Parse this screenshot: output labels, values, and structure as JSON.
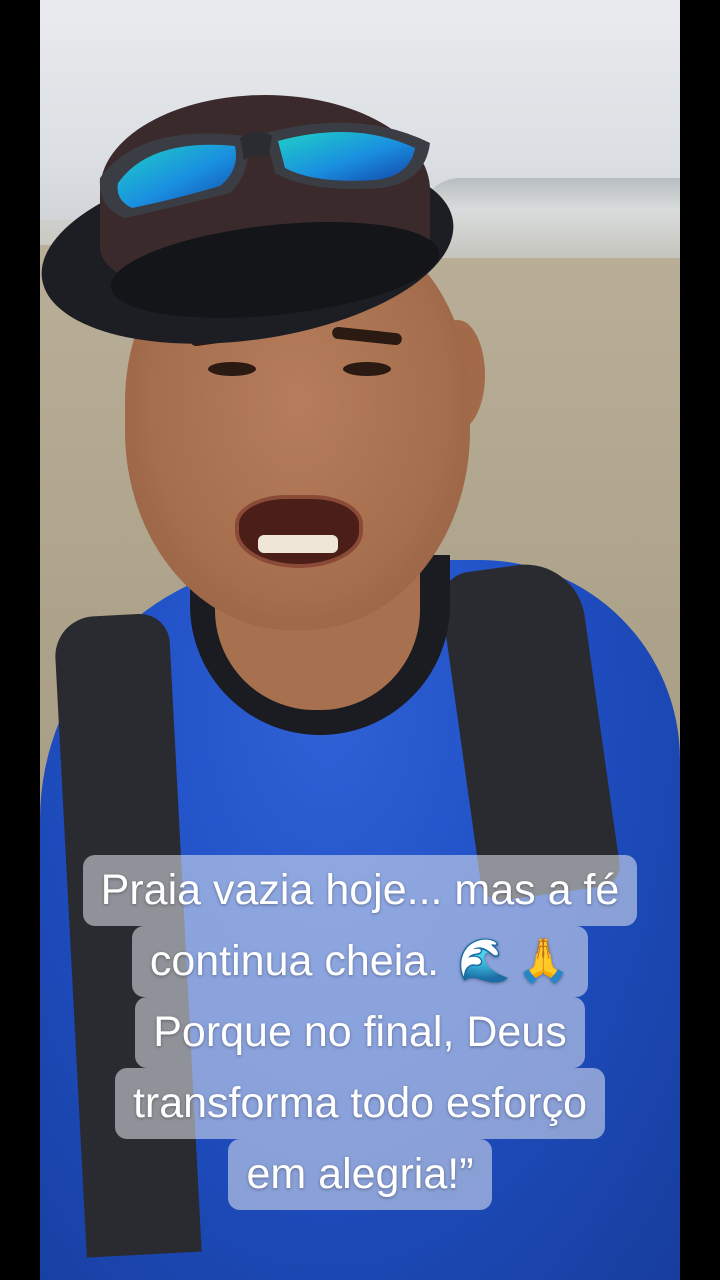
{
  "caption": {
    "line1": "Praia vazia hoje... mas a fé",
    "line2_text": "continua cheia.",
    "line2_emoji1": "🌊",
    "line2_emoji2": "🙏",
    "line3": "Porque no final, Deus",
    "line4": "transforma todo esforço",
    "line5": "em alegria!”"
  },
  "icons": {
    "emoji1": "water-wave-icon",
    "emoji2": "folded-hands-icon"
  },
  "colors": {
    "shirt": "#1f4fc4",
    "caption_bg": "rgba(228,232,240,0.55)",
    "caption_text": "#ffffff"
  }
}
